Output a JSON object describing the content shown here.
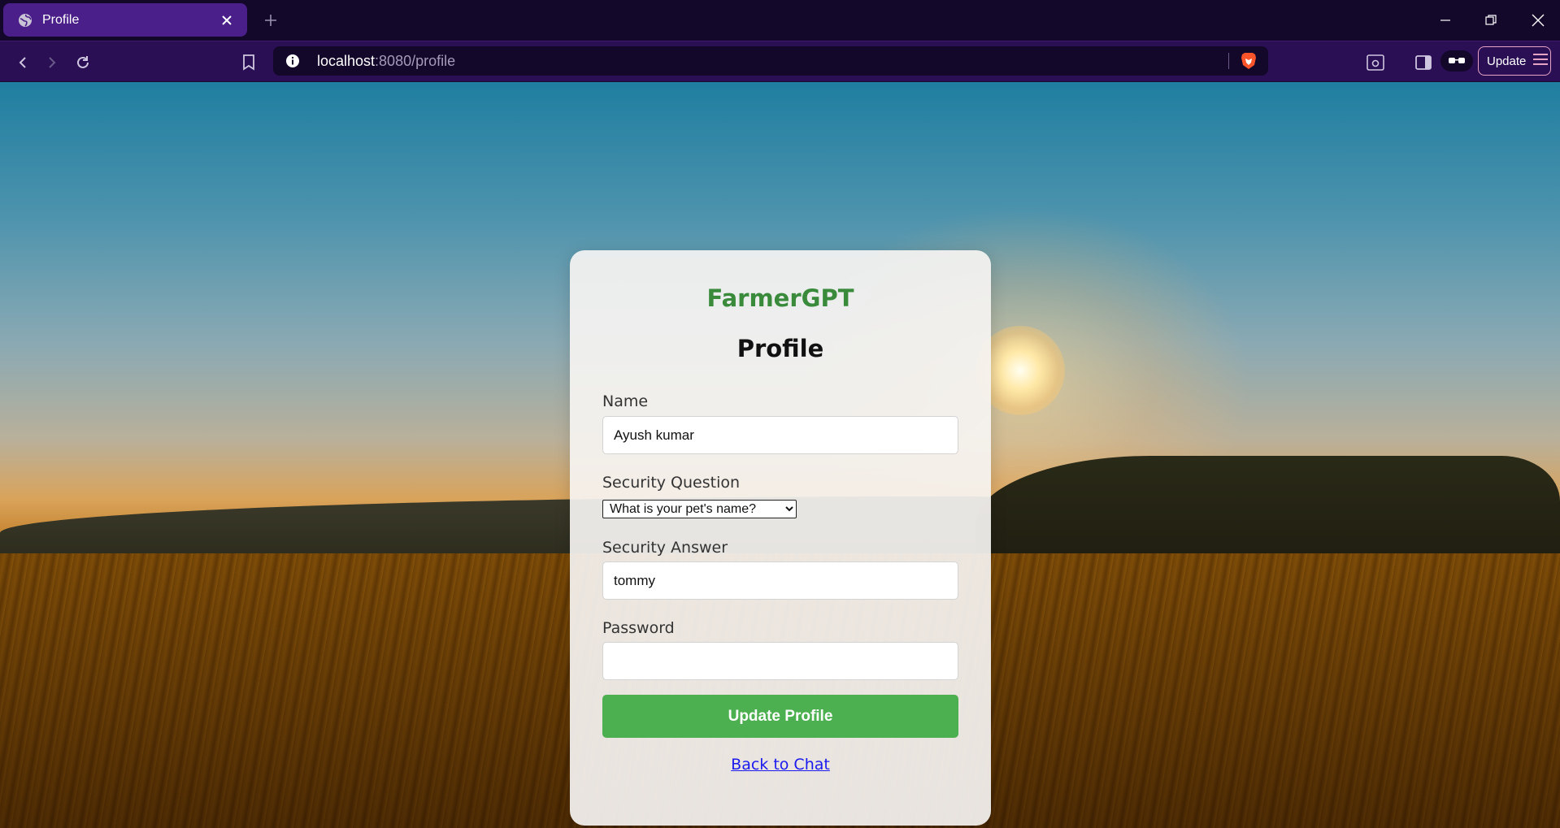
{
  "browser": {
    "tab_title": "Profile",
    "url_host": "localhost",
    "url_path": ":8080/profile",
    "update_label": "Update"
  },
  "page": {
    "brand": "FarmerGPT",
    "heading": "Profile",
    "name_label": "Name",
    "name_value": "Ayush kumar",
    "security_question_label": "Security Question",
    "security_question_selected": "What is your pet's name?",
    "security_answer_label": "Security Answer",
    "security_answer_value": "tommy",
    "password_label": "Password",
    "password_value": "",
    "submit_label": "Update Profile",
    "back_link": "Back to Chat"
  },
  "colors": {
    "brand_green": "#3a8a3c",
    "button_green": "#4caf50",
    "link_blue": "#1a1aee",
    "tab_active": "#4a1f8a",
    "toolbar": "#2a0f55"
  },
  "icons": [
    "globe-icon",
    "close-icon",
    "plus-icon",
    "minimize-icon",
    "restore-icon",
    "back-arrow-icon",
    "forward-arrow-icon",
    "reload-icon",
    "bookmark-icon",
    "info-icon",
    "brave-lion-icon",
    "screenshot-icon",
    "sidebar-icon",
    "glasses-icon",
    "menu-icon"
  ]
}
